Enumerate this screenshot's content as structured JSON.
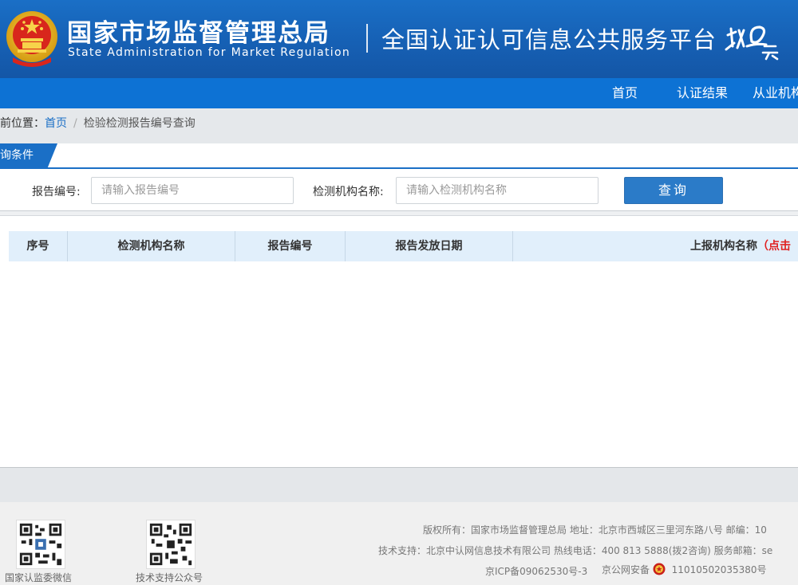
{
  "header": {
    "org_cn": "国家市场监督管理总局",
    "org_en": "State Administration  for  Market Regulation",
    "platform": "全国认证认可信息公共服务平台",
    "brand_text": "认云"
  },
  "nav": {
    "items": [
      "首页",
      "认证结果",
      "从业机构"
    ]
  },
  "breadcrumb": {
    "prefix": "前位置：",
    "home": "首页",
    "separator": "/",
    "current": "检验检测报告编号查询"
  },
  "conditions": {
    "tab_label": "询条件",
    "report_no_label": "报告编号:",
    "report_no_placeholder": "请输入报告编号",
    "report_no_value": "",
    "org_name_label": "检测机构名称:",
    "org_name_placeholder": "请输入检测机构名称",
    "org_name_value": "",
    "query_button": "查询"
  },
  "table": {
    "columns": [
      "序号",
      "检测机构名称",
      "报告编号",
      "报告发放日期",
      "上报机构名称"
    ],
    "last_col_note": "（点击",
    "rows": []
  },
  "footer": {
    "qr1_caption": "国家认监委微信",
    "qr2_caption": "技术支持公众号",
    "line1": "版权所有：国家市场监督管理总局    地址：北京市西城区三里河东路八号    邮编：10",
    "line2": "技术支持：北京中认网信息技术有限公司    热线电话：400 813 5888(拨2咨询)    服务邮箱：se",
    "icp": "京ICP备09062530号-3",
    "police_prefix": "京公网安备",
    "police_no": "11010502035380号"
  },
  "colors": {
    "header_blue": "#1660b4",
    "nav_blue": "#0d72d4",
    "accent": "#1a6fc6",
    "button": "#2b7bc8",
    "table_head": "#e1effb",
    "warning_red": "#e02020"
  }
}
